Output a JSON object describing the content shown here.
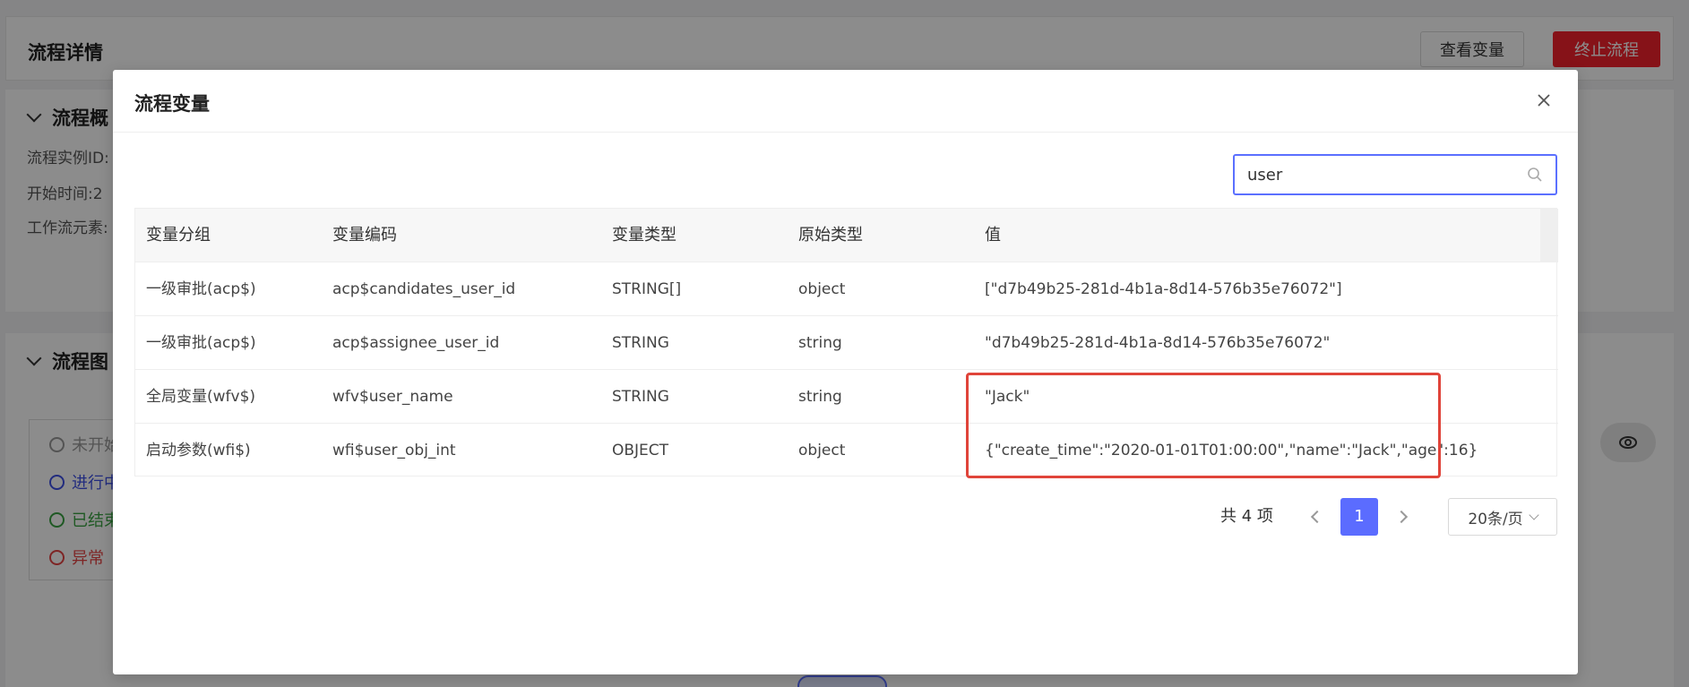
{
  "background": {
    "title": "流程详情",
    "view_vars_label": "查看变量",
    "stop_label": "终止流程",
    "section1_title": "流程概",
    "fields": [
      "流程实例ID:",
      "开始时间:2",
      "工作流元素:"
    ],
    "section2_title": "流程图",
    "legend": [
      {
        "label": "未开始",
        "color": "#999999"
      },
      {
        "label": "进行中",
        "color": "#3f51e6"
      },
      {
        "label": "已结束",
        "color": "#3aa342"
      },
      {
        "label": "异常",
        "color": "#e54444"
      }
    ]
  },
  "modal": {
    "title": "流程变量",
    "search": {
      "value": "user",
      "placeholder": ""
    },
    "columns": {
      "group": "变量分组",
      "code": "变量编码",
      "type": "变量类型",
      "orig": "原始类型",
      "value": "值"
    },
    "rows": [
      {
        "group": "一级审批(acp$)",
        "code": "acp$candidates_user_id",
        "type": "STRING[]",
        "orig": "object",
        "value": "[\"d7b49b25-281d-4b1a-8d14-576b35e76072\"]"
      },
      {
        "group": "一级审批(acp$)",
        "code": "acp$assignee_user_id",
        "type": "STRING",
        "orig": "string",
        "value": "\"d7b49b25-281d-4b1a-8d14-576b35e76072\""
      },
      {
        "group": "全局变量(wfv$)",
        "code": "wfv$user_name",
        "type": "STRING",
        "orig": "string",
        "value": "\"Jack\""
      },
      {
        "group": "启动参数(wfi$)",
        "code": "wfi$user_obj_int",
        "type": "OBJECT",
        "orig": "object",
        "value": "{\"create_time\":\"2020-01-01T01:00:00\",\"name\":\"Jack\",\"age\":16}"
      }
    ],
    "pagination": {
      "total": "共 4 项",
      "current": "1",
      "page_size": "20条/页"
    }
  },
  "colors": {
    "primary": "#5b6cff",
    "danger": "#f5222d",
    "highlight": "#e0443a"
  }
}
